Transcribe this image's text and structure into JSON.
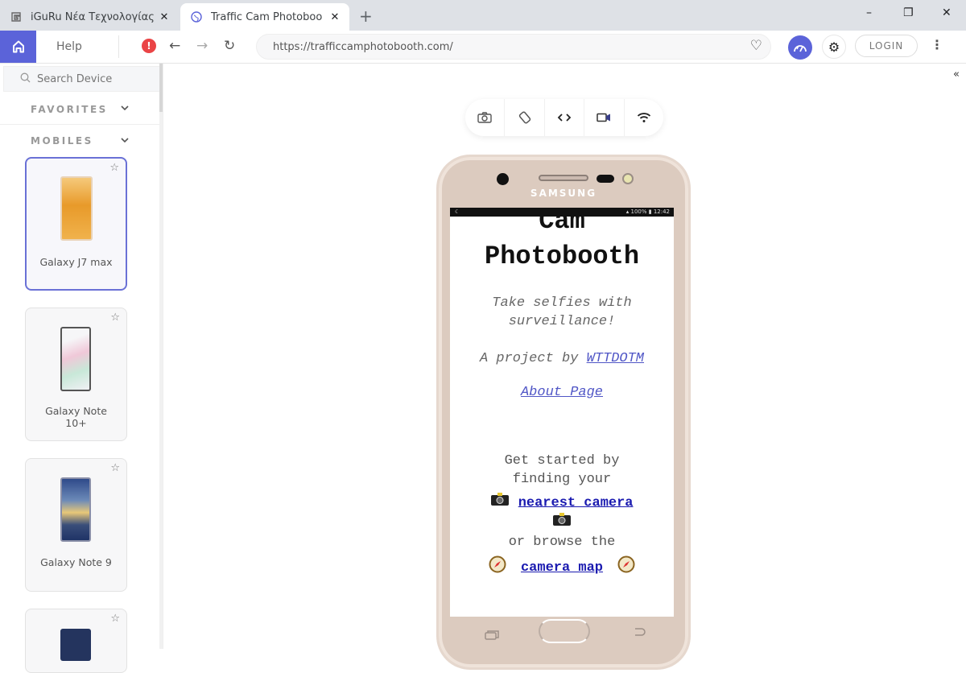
{
  "browser": {
    "tabs": [
      {
        "title": "iGuRu Νέα Τεχνολογίας",
        "icon": "iguru-favicon",
        "active": false
      },
      {
        "title": "Traffic Cam Photoboo",
        "icon": "globe-favicon",
        "active": true
      }
    ],
    "new_tab_label": "+",
    "window_controls": {
      "minimize": "–",
      "maximize": "❐",
      "close": "✕"
    },
    "tab_close": "✕"
  },
  "toolbar": {
    "help_label": "Help",
    "alert_label": "!",
    "back": "←",
    "forward": "→",
    "reload": "↻",
    "url": "https://trafficcamphotobooth.com/",
    "favorite": "♡",
    "login_label": "LOGIN",
    "more": "⋮",
    "settings": "⚙"
  },
  "sidebar": {
    "search_placeholder": "Search Device",
    "search_icon": "⚲",
    "sections": [
      {
        "label": "FAVORITES",
        "chevron": "⌄"
      },
      {
        "label": "MOBILES",
        "chevron": "⌄"
      }
    ],
    "devices": [
      {
        "name": "Galaxy J7 max",
        "selected": true,
        "star": "☆"
      },
      {
        "name": "Galaxy Note 10+",
        "selected": false,
        "star": "☆"
      },
      {
        "name": "Galaxy Note 9",
        "selected": false,
        "star": "☆"
      },
      {
        "name": "",
        "selected": false,
        "star": "☆"
      }
    ]
  },
  "main": {
    "collapse_label": "«",
    "tools": [
      "screenshot",
      "rotate",
      "devtools",
      "record",
      "network"
    ],
    "phone": {
      "brand": "SAMSUNG",
      "status_left": "☾",
      "status_right": "▴ 100% ▮ 12:42",
      "page": {
        "title_line1": "Cam",
        "title_line2": "Photobooth",
        "tagline_line1": "Take selfies with",
        "tagline_line2": "surveillance!",
        "project_prefix": "A project by ",
        "project_link": "WTTDOTM",
        "about_link": "About Page",
        "start_line1": "Get started by",
        "start_line2": "finding your",
        "nearest_link": "nearest camera",
        "browse_text": "or browse the",
        "map_link": "camera map",
        "camera_emoji": "📷",
        "compass_emoji": "🧭"
      }
    }
  }
}
